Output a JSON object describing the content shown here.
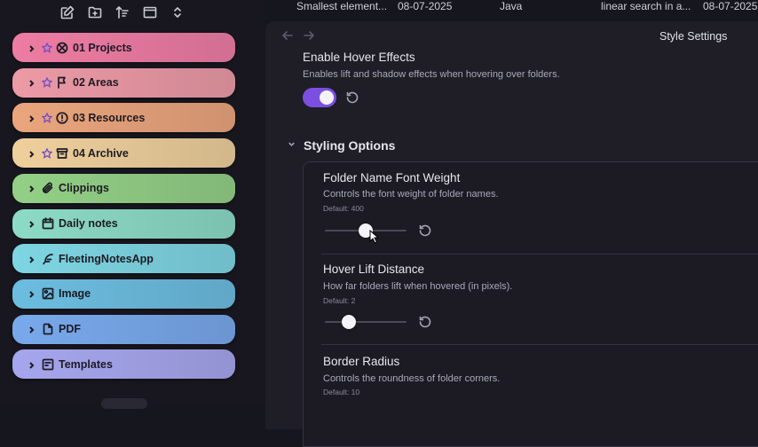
{
  "toolbar": {
    "icons": [
      "new-note-icon",
      "new-folder-icon",
      "sort-icon",
      "collapse-icon",
      "expand-collapse-icon"
    ]
  },
  "folders": [
    {
      "label": "01 Projects",
      "icon": "projects-icon",
      "starred": true,
      "color": "#ee7ca3"
    },
    {
      "label": "02 Areas",
      "icon": "flag-icon",
      "starred": true,
      "color": "#ec9aa6"
    },
    {
      "label": "03 Resources",
      "icon": "alert-circle-icon",
      "starred": true,
      "color": "#eba57c"
    },
    {
      "label": "04 Archive",
      "icon": "archive-icon",
      "starred": true,
      "color": "#efd09c"
    },
    {
      "label": "Clippings",
      "icon": "paperclip-icon",
      "starred": false,
      "color": "#93d086"
    },
    {
      "label": "Daily notes",
      "icon": "calendar-icon",
      "starred": false,
      "color": "#8cdbc6"
    },
    {
      "label": "FleetingNotesApp",
      "icon": "feather-icon",
      "starred": false,
      "color": "#7ed6e3"
    },
    {
      "label": "Image",
      "icon": "image-icon",
      "starred": false,
      "color": "#6cbde0"
    },
    {
      "label": "PDF",
      "icon": "file-icon",
      "starred": false,
      "color": "#78a9ec"
    },
    {
      "label": "Templates",
      "icon": "template-icon",
      "starred": false,
      "color": "#a6a6ee"
    }
  ],
  "topstrip": {
    "item1_name": "Smallest element...",
    "item1_date": "08-07-2025",
    "item1_lang": "Java",
    "item2_name": "linear search in a...",
    "item2_date": "08-07-2025"
  },
  "modal": {
    "title": "Style Settings",
    "hover_effects": {
      "title": "Enable Hover Effects",
      "desc": "Enables lift and shadow effects when hovering over folders.",
      "enabled": true
    },
    "section": "Styling Options",
    "font_weight": {
      "title": "Folder Name Font Weight",
      "desc": "Controls the font weight of folder names.",
      "default": "Default: 400",
      "slider_fraction": 0.5
    },
    "lift": {
      "title": "Hover Lift Distance",
      "desc": "How far folders lift when hovered (in pixels).",
      "default": "Default: 2",
      "slider_fraction": 0.25
    },
    "radius": {
      "title": "Border Radius",
      "desc": "Controls the roundness of folder corners.",
      "default": "Default: 10"
    }
  },
  "colors": {
    "accent": "#7c4fe0",
    "background": "#16161e",
    "panel": "#1f1e27"
  }
}
